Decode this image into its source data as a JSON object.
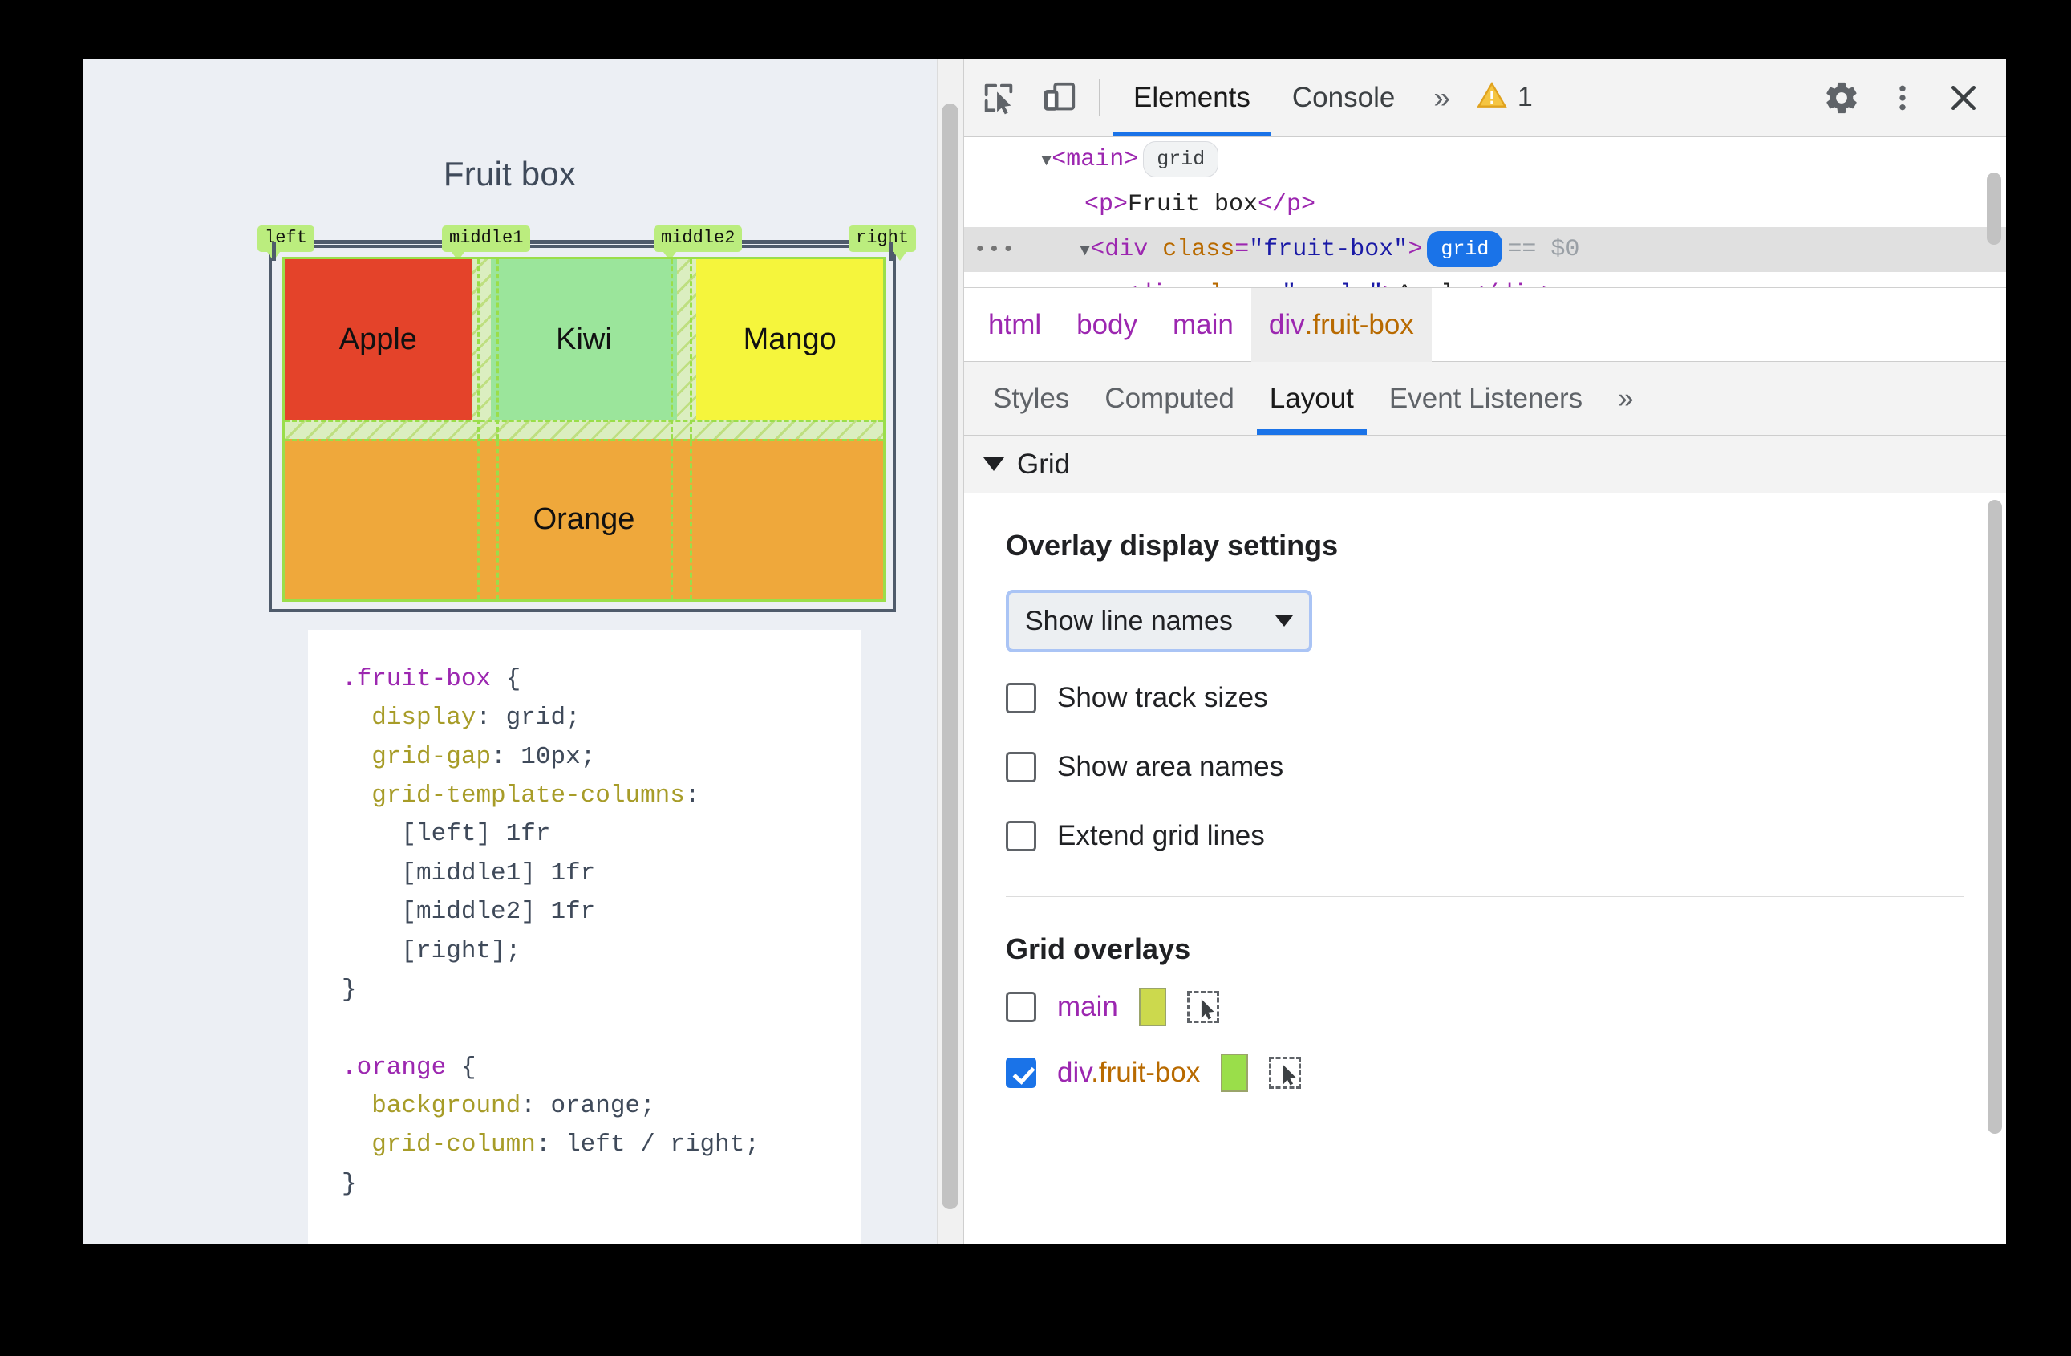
{
  "webpage": {
    "title": "Fruit box",
    "grid_line_names": [
      "left",
      "middle1",
      "middle2",
      "right"
    ],
    "cells": [
      {
        "label": "Apple",
        "color": "#e4432a"
      },
      {
        "label": "Kiwi",
        "color": "#9be59b"
      },
      {
        "label": "Mango",
        "color": "#f5f53c"
      },
      {
        "label": "Orange",
        "color": "#efa83b"
      }
    ],
    "code": {
      "rule1": {
        "selector": ".fruit-box",
        "open": " {",
        "lines": [
          {
            "prop": "display",
            "value": "grid"
          },
          {
            "prop": "grid-gap",
            "value": "10px"
          },
          {
            "prop": "grid-template-columns",
            "value": ""
          }
        ],
        "track_list": [
          "[left] 1fr",
          "[middle1] 1fr",
          "[middle2] 1fr",
          "[right];"
        ],
        "close": "}"
      },
      "rule2": {
        "selector": ".orange",
        "open": " {",
        "lines": [
          {
            "prop": "background",
            "value": "orange"
          },
          {
            "prop": "grid-column",
            "value": "left / right"
          }
        ],
        "close": "}"
      }
    }
  },
  "devtools": {
    "toolbar": {
      "inspect_icon": "inspect-element-icon",
      "device_icon": "device-toolbar-icon",
      "tabs": [
        {
          "label": "Elements",
          "active": true
        },
        {
          "label": "Console",
          "active": false
        }
      ],
      "more_tabs_icon": "»",
      "warning_count": "1",
      "warning_icon": "warning-triangle-icon",
      "settings_icon": "gear-icon",
      "more_icon": "kebab-menu-icon",
      "close_icon": "close-icon"
    },
    "dom_tree": {
      "rows": [
        {
          "twisty": "▼",
          "open_punc": "<",
          "tag": "main",
          "close_punc": ">",
          "badge": "grid",
          "badge_on": false
        },
        {
          "text": "<p>Fruit box</p>",
          "p_open": "<p>",
          "p_text": "Fruit box",
          "p_close": "</p>"
        },
        {
          "gutter": "•••",
          "twisty": "▼",
          "open_punc": "<",
          "tag": "div",
          "attr_name": "class",
          "attr_value": "\"fruit-box\"",
          "close_punc": ">",
          "badge": "grid",
          "badge_on": true,
          "eq": "== $0"
        },
        {
          "open_punc": "<",
          "tag": "div",
          "attr_name": "class",
          "attr_value": "\"apple\"",
          "close_punc": ">",
          "inner": "Apple",
          "end_tag": "</div>"
        }
      ]
    },
    "breadcrumb": [
      {
        "label": "html",
        "active": false
      },
      {
        "label": "body",
        "active": false
      },
      {
        "label": "main",
        "active": false
      },
      {
        "label": "div.fruit-box",
        "active": true,
        "tag": "div",
        "cls": ".fruit-box"
      }
    ],
    "sidebar_tabs": [
      {
        "label": "Styles",
        "active": false
      },
      {
        "label": "Computed",
        "active": false
      },
      {
        "label": "Layout",
        "active": true
      },
      {
        "label": "Event Listeners",
        "active": false
      }
    ],
    "sidebar_more_icon": "»",
    "layout": {
      "section_title": "Grid",
      "overlay_settings_title": "Overlay display settings",
      "overlay_select_value": "Show line names",
      "checkboxes": [
        {
          "label": "Show track sizes",
          "checked": false
        },
        {
          "label": "Show area names",
          "checked": false
        },
        {
          "label": "Extend grid lines",
          "checked": false
        }
      ],
      "grid_overlays_title": "Grid overlays",
      "overlays": [
        {
          "name": "main",
          "checked": false,
          "color": "#ccd94d",
          "tag": "main",
          "cls": ""
        },
        {
          "name": "div.fruit-box",
          "checked": true,
          "color": "#9ade4a",
          "tag": "div",
          "cls": ".fruit-box"
        }
      ]
    }
  },
  "colors": {
    "accent_blue": "#1a73e8",
    "grid_green": "#9ade4a",
    "badge_green": "#bbed7e",
    "warning_yellow": "#e8a33d",
    "page_bg": "#eceff4"
  }
}
